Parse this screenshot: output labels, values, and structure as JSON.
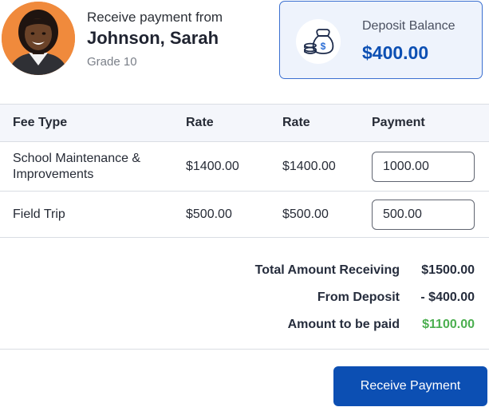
{
  "payer": {
    "caption": "Receive payment from",
    "name": "Johnson, Sarah",
    "grade": "Grade 10"
  },
  "deposit": {
    "label": "Deposit Balance",
    "value": "$400.00",
    "icon": "money-bag-coins-icon"
  },
  "fees": {
    "headers": [
      "Fee Type",
      "Rate",
      "Rate",
      "Payment"
    ],
    "rows": [
      {
        "type": "School Maintenance & Improvements",
        "rate1": "$1400.00",
        "rate2": "$1400.00",
        "payment": "1000.00"
      },
      {
        "type": "Field Trip",
        "rate1": "$500.00",
        "rate2": "$500.00",
        "payment": "500.00"
      }
    ]
  },
  "summary": {
    "total_label": "Total Amount Receiving",
    "total_value": "$1500.00",
    "deposit_label": "From Deposit",
    "deposit_value": "- $400.00",
    "due_label": "Amount to be paid",
    "due_value": "$1100.00"
  },
  "actions": {
    "receive_label": "Receive Payment"
  },
  "colors": {
    "accent": "#0c4fb3",
    "positive": "#4caf50",
    "avatar_bg": "#f08a3c"
  }
}
